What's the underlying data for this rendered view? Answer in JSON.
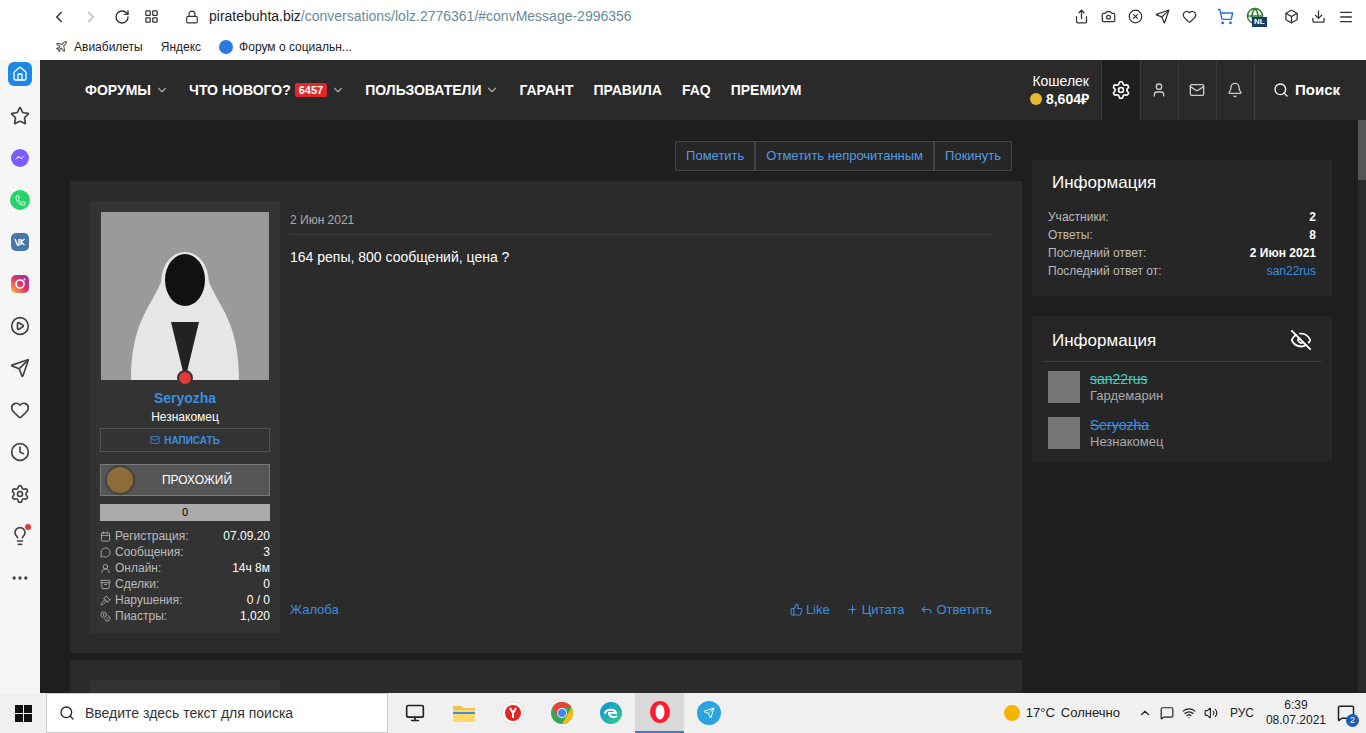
{
  "browser": {
    "url_domain": "piratebuhta.biz",
    "url_path": "/conversations/lolz.2776361/#convMessage-2996356",
    "region_badge": "NL",
    "bookmarks": [
      {
        "label": "Авиабилеты",
        "kind": "plane"
      },
      {
        "label": "Яндекс",
        "kind": "none"
      },
      {
        "label": "Форум о социальн...",
        "kind": "zforum"
      }
    ]
  },
  "sidebar": [
    {
      "kind": "home",
      "selected": true,
      "badge": false
    },
    {
      "kind": "star",
      "selected": false,
      "badge": false
    },
    {
      "kind": "messenger",
      "selected": false,
      "badge": false
    },
    {
      "kind": "whatsapp",
      "selected": false,
      "badge": false
    },
    {
      "kind": "vk",
      "selected": false,
      "badge": false
    },
    {
      "kind": "instagram",
      "selected": false,
      "badge": false
    },
    {
      "kind": "player",
      "selected": false,
      "badge": false
    },
    {
      "kind": "send",
      "selected": false,
      "badge": false
    },
    {
      "kind": "heart",
      "selected": false,
      "badge": false
    },
    {
      "kind": "clock",
      "selected": false,
      "badge": false
    },
    {
      "kind": "settings",
      "selected": false,
      "badge": false
    },
    {
      "kind": "lightbulb",
      "selected": false,
      "badge": true
    },
    {
      "kind": "more",
      "selected": false,
      "badge": false
    }
  ],
  "site_nav": [
    {
      "label": "ФОРУМЫ",
      "dropdown": true,
      "badge": ""
    },
    {
      "label": "ЧТО НОВОГО?",
      "dropdown": true,
      "badge": "6457"
    },
    {
      "label": "ПОЛЬЗОВАТЕЛИ",
      "dropdown": true,
      "badge": ""
    },
    {
      "label": "ГАРАНТ",
      "dropdown": false,
      "badge": ""
    },
    {
      "label": "ПРАВИЛА",
      "dropdown": false,
      "badge": ""
    },
    {
      "label": "FAQ",
      "dropdown": false,
      "badge": ""
    },
    {
      "label": "ПРЕМИУМ",
      "dropdown": false,
      "badge": ""
    }
  ],
  "wallet": {
    "label": "Кошелек",
    "amount": "8,604₽"
  },
  "search_label": "Поиск",
  "thread_actions": [
    "Пометить",
    "Отметить непрочитанным",
    "Покинуть"
  ],
  "message": {
    "author": {
      "name": "Seryozha",
      "title": "Незнакомец",
      "write_button": "НАПИСАТЬ",
      "rank": "ПРОХОЖИЙ",
      "rank_bar": "0",
      "stats": [
        {
          "label": "Регистрация:",
          "value": "07.09.20"
        },
        {
          "label": "Сообщения:",
          "value": "3"
        },
        {
          "label": "Онлайн:",
          "value": "14ч 8м"
        },
        {
          "label": "Сделки:",
          "value": "0"
        },
        {
          "label": "Нарушения:",
          "value": "0 / 0"
        },
        {
          "label": "Пиастры:",
          "value": "1,020"
        }
      ]
    },
    "date": "2 Июн 2021",
    "text": "164 репы, 800 сообщений, цена ?",
    "report": "Жалоба",
    "actions": [
      "Like",
      "Цитата",
      "Ответить"
    ]
  },
  "info": {
    "title": "Информация",
    "rows": [
      {
        "label": "Участники:",
        "value": "2",
        "link": false
      },
      {
        "label": "Ответы:",
        "value": "8",
        "link": false
      },
      {
        "label": "Последний ответ:",
        "value": "2 Июн 2021",
        "link": false
      },
      {
        "label": "Последний ответ от:",
        "value": "san22rus",
        "link": true
      }
    ]
  },
  "participants": {
    "title": "Информация",
    "members": [
      {
        "name": "san22rus",
        "title": "Гардемарин",
        "color": "#3fd0c4"
      },
      {
        "name": "Seryozha",
        "title": "Незнакомец",
        "color": "#3b8ee0"
      }
    ]
  },
  "taskbar": {
    "search_placeholder": "Введите здесь текст для поиска",
    "apps": [
      {
        "kind": "task-view",
        "active": false
      },
      {
        "kind": "explorer",
        "active": false
      },
      {
        "kind": "yandex",
        "active": false
      },
      {
        "kind": "chrome",
        "active": false
      },
      {
        "kind": "edge",
        "active": false
      },
      {
        "kind": "opera",
        "active": true
      },
      {
        "kind": "telegram",
        "active": false
      }
    ],
    "weather": {
      "temp": "17°C",
      "condition": "Солнечно"
    },
    "language": "РУС",
    "time": "6:39",
    "date": "08.07.2021",
    "notifications": "2"
  }
}
